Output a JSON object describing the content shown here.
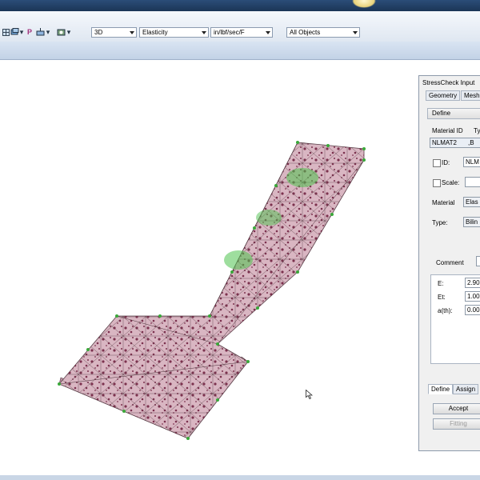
{
  "toolbar": {
    "view_mode": "3D",
    "analysis_type": "Elasticity",
    "units": "in/lbf/sec/F",
    "object_filter": "All Objects",
    "icon_p": "P"
  },
  "panel": {
    "title": "StressCheck Input",
    "tabs": [
      "Geometry",
      "Mesh"
    ],
    "define_dropdown": "Define",
    "col_material_id": "Material ID",
    "col_type": "Ty",
    "material_id_value": "NLMAT2",
    "material_type_value": ",B",
    "id_label": "ID:",
    "id_value": "NLM",
    "scale_label": "Scale:",
    "material_label": "Material",
    "material_value": "Elas",
    "type_label": "Type:",
    "type_value": "Bilin",
    "comment_label": "Comment",
    "props": [
      {
        "name": "E:",
        "value": "2.90"
      },
      {
        "name": "Et:",
        "value": "1.00"
      },
      {
        "name": "a(th):",
        "value": "0.00"
      }
    ],
    "bottom_tabs": [
      "Define",
      "Assign"
    ],
    "accept_label": "Accept",
    "fitting_label": "Fitting"
  },
  "colors": {
    "mesh_fill": "#d9b6c2",
    "mesh_lines": "#5a3f48",
    "node_dots": "#3aa83a",
    "hotspot": "#4fc24f",
    "accent_dark": "#6b1a3a"
  }
}
